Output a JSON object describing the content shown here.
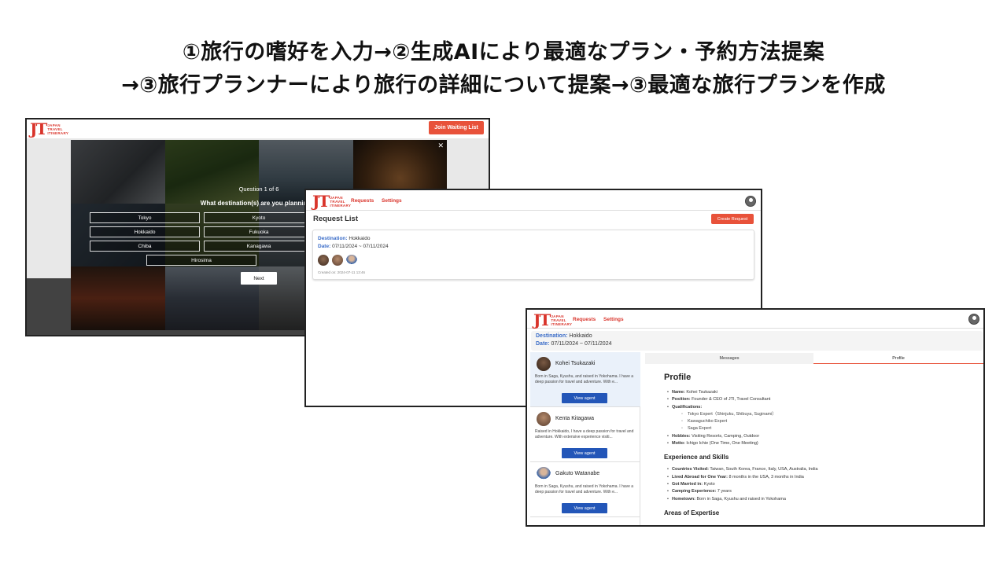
{
  "headline": {
    "line1": "①旅行の嗜好を入力→②生成AIにより最適なプラン・予約方法提案",
    "line2": "→③旅行プランナーにより旅行の詳細について提案→③最適な旅行プランを作成"
  },
  "logo": {
    "mark": "JT",
    "line1": "JAPAN",
    "line2": "TRAVEL",
    "line3": "ITINERARY"
  },
  "colors": {
    "accent": "#e8523a",
    "brand_red": "#d9342b",
    "link_blue": "#3a6cc8",
    "button_blue": "#2356b8"
  },
  "screen1": {
    "waitlist_label": "Join Waiting List",
    "close_icon": "✕",
    "question_count": "Question 1 of 6",
    "question": "What destination(s) are you planning tr",
    "options": [
      "Tokyo",
      "Kyoto",
      "Hokkaido",
      "Fukuoka",
      "Chiba",
      "Kanagawa",
      "Hirosima"
    ],
    "next_label": "Next"
  },
  "screen2": {
    "nav": {
      "requests": "Requests",
      "settings": "Settings",
      "user_icon": "user-circle-icon"
    },
    "title": "Request List",
    "create_label": "Create Request",
    "card": {
      "destination_label": "Destination:",
      "destination": "Hokkaido",
      "date_label": "Date:",
      "date": "07/11/2024 ~ 07/11/2024",
      "created": "Created on: 2024-07-11 13:46"
    }
  },
  "screen3": {
    "nav": {
      "requests": "Requests",
      "settings": "Settings",
      "user_icon": "user-circle-icon"
    },
    "destination_label": "Destination:",
    "destination": "Hokkaido",
    "date_label": "Date:",
    "date": "07/11/2024 ~ 07/11/2024",
    "agents": [
      {
        "name": "Kohei Tsukazaki",
        "bio": "Born in Saga, Kyushu, and raised in Yokohama. I have a deep passion for travel and adventure. With e...",
        "button": "View agent"
      },
      {
        "name": "Kenta Kitagawa",
        "bio": "Raised in Hokkaido, I have a deep passion for travel and adventure. With extensive experience visiti...",
        "button": "View agent"
      },
      {
        "name": "Gakuto Watanabe",
        "bio": "Born in Saga, Kyushu, and raised in Yokohama. I have a deep passion for travel and adventure. With e...",
        "button": "View agent"
      }
    ],
    "tabs": {
      "messages": "Messages",
      "profile": "Profile"
    },
    "profile": {
      "title": "Profile",
      "name_label": "Name:",
      "name": "Kohei Tsukazaki",
      "position_label": "Position:",
      "position": "Founder & CEO of JTI, Travel Consultant",
      "qualifications_label": "Qualifications:",
      "qualifications": [
        "Tokyo Expert（Shinjuku, Shibuya, Suginami）",
        "Kawaguchiko Expert",
        "Saga Expert"
      ],
      "hobbies_label": "Hobbies:",
      "hobbies": "Visiting Resorts, Camping, Outdoor",
      "motto_label": "Motto:",
      "motto": "Ichigo Ichie (One Time, One Meeting)",
      "exp_title": "Experience and Skills",
      "countries_label": "Countries Visited:",
      "countries": "Taiwan, South Korea, France, Italy, USA, Australia, India",
      "abroad_label": "Lived Abroad for One Year:",
      "abroad": "8 months in the USA, 3 months in India",
      "married_label": "Got Married in:",
      "married": "Kyoto",
      "camping_label": "Camping Experience:",
      "camping": "7 years",
      "hometown_label": "Hometown:",
      "hometown": "Born in Saga, Kyushu and raised in Yokohama",
      "areas_title": "Areas of Expertise"
    }
  }
}
